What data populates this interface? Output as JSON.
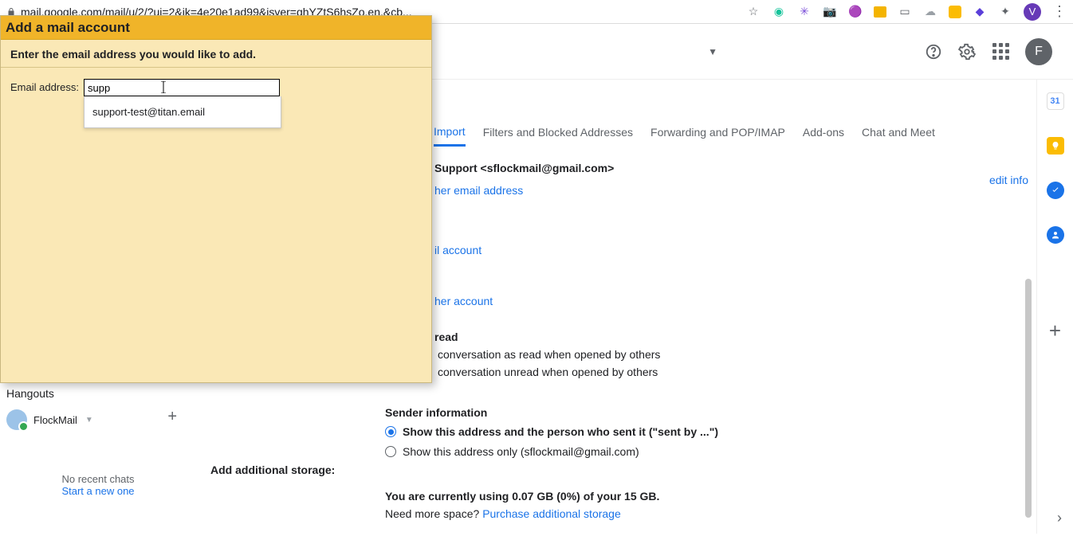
{
  "chrome": {
    "url": "mail.google.com/mail/u/2/?ui=2&ik=4e20e1ad99&jsver=qhYZtS6hsZo.en.&cb...",
    "avatar_letter": "V"
  },
  "header": {
    "avatar_letter": "F"
  },
  "rail": {
    "calendar_day": "31"
  },
  "tabs": {
    "import": "Import",
    "filters": "Filters and Blocked Addresses",
    "forwarding": "Forwarding and POP/IMAP",
    "addons": "Add-ons",
    "chat": "Chat and Meet"
  },
  "main": {
    "support_line": "Support <sflockmail@gmail.com>",
    "edit_info": "edit info",
    "another_email": "her email address",
    "mail_account": "il account",
    "other_account": "her account",
    "read_head": "read",
    "read1": "conversation as read when opened by others",
    "read2": "conversation unread when opened by others",
    "sender_head": "Sender information",
    "sender_opt1": "Show this address and the person who sent it (\"sent by ...\")",
    "sender_opt2": "Show this address only (sflockmail@gmail.com)",
    "storage_label": "Add additional storage:",
    "storage_line": "You are currently using 0.07 GB (0%) of your 15 GB.",
    "storage_more": "Need more space? ",
    "storage_link": "Purchase additional storage"
  },
  "hangouts": {
    "title": "Hangouts",
    "user": "FlockMail",
    "no_chat": "No recent chats",
    "start": "Start a new one"
  },
  "modal": {
    "title": "Add a mail account",
    "subtitle": "Enter the email address you would like to add.",
    "label": "Email address:",
    "value": "supp",
    "suggestion": "support-test@titan.email"
  }
}
